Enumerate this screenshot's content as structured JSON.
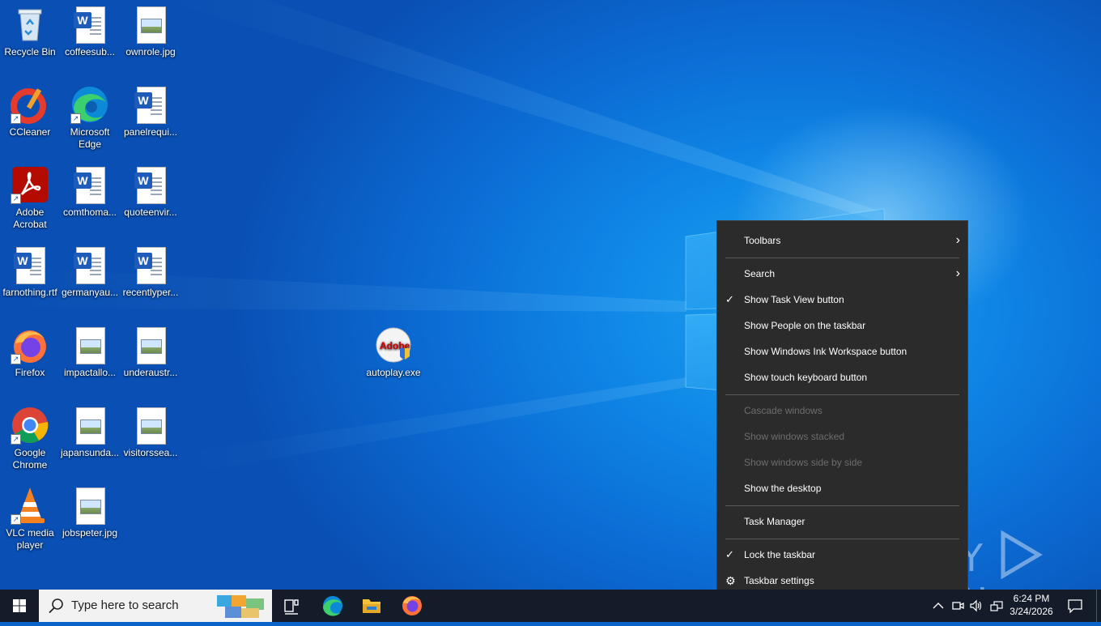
{
  "desktop": {
    "icons": [
      {
        "label": "Recycle Bin",
        "icon": "recycle-bin-icon"
      },
      {
        "label": "coffeesub...",
        "icon": "word-doc-icon"
      },
      {
        "label": "ownrole.jpg",
        "icon": "image-file-icon"
      },
      {
        "label": "CCleaner",
        "icon": "ccleaner-icon"
      },
      {
        "label": "Microsoft Edge",
        "icon": "edge-icon"
      },
      {
        "label": "panelrequi...",
        "icon": "word-doc-icon"
      },
      {
        "label": "Adobe Acrobat",
        "icon": "acrobat-icon"
      },
      {
        "label": "comthoma...",
        "icon": "word-doc-icon"
      },
      {
        "label": "quoteenvir...",
        "icon": "word-doc-icon"
      },
      {
        "label": "farnothing.rtf",
        "icon": "word-doc-icon"
      },
      {
        "label": "germanyau...",
        "icon": "word-doc-icon"
      },
      {
        "label": "recentlyper...",
        "icon": "word-doc-icon"
      },
      {
        "label": "Firefox",
        "icon": "firefox-icon"
      },
      {
        "label": "impactallo...",
        "icon": "image-file-icon"
      },
      {
        "label": "underaustr...",
        "icon": "image-file-icon"
      },
      {
        "label": "Google Chrome",
        "icon": "chrome-icon"
      },
      {
        "label": "japansunda...",
        "icon": "image-file-icon"
      },
      {
        "label": "visitorssea...",
        "icon": "image-file-icon"
      },
      {
        "label": "VLC media player",
        "icon": "vlc-icon"
      },
      {
        "label": "jobspeter.jpg",
        "icon": "image-file-icon"
      },
      {
        "label": "autoplay.exe",
        "icon": "adobe-installer-icon"
      }
    ]
  },
  "context_menu": {
    "items": [
      {
        "label": "Toolbars",
        "submenu": true,
        "checked": false,
        "enabled": true
      },
      {
        "label": "Search",
        "submenu": true,
        "checked": false,
        "enabled": true
      },
      {
        "label": "Show Task View button",
        "checked": true,
        "enabled": true
      },
      {
        "label": "Show People on the taskbar",
        "checked": false,
        "enabled": true
      },
      {
        "label": "Show Windows Ink Workspace button",
        "checked": false,
        "enabled": true
      },
      {
        "label": "Show touch keyboard button",
        "checked": false,
        "enabled": true
      },
      {
        "label": "Cascade windows",
        "checked": false,
        "enabled": false
      },
      {
        "label": "Show windows stacked",
        "checked": false,
        "enabled": false
      },
      {
        "label": "Show windows side by side",
        "checked": false,
        "enabled": false
      },
      {
        "label": "Show the desktop",
        "checked": false,
        "enabled": true
      },
      {
        "label": "Task Manager",
        "checked": false,
        "enabled": true
      },
      {
        "label": "Lock the taskbar",
        "checked": true,
        "enabled": true
      },
      {
        "label": "Taskbar settings",
        "icon": "gear-icon",
        "enabled": true
      }
    ]
  },
  "watermark": {
    "text_left": "ANY",
    "text_right": "RUN"
  },
  "taskbar": {
    "search_placeholder": "Type here to search",
    "pinned": [
      "task-view-icon",
      "edge-icon",
      "file-explorer-icon",
      "firefox-icon"
    ],
    "tray_icons": [
      "chevron-up-icon",
      "meet-now-icon",
      "volume-icon",
      "network-icon"
    ],
    "clock": {
      "time": "6:24 PM",
      "date": "3/24/2026"
    }
  },
  "colors": {
    "menu_bg": "#2b2b2b",
    "menu_disabled": "#6d6d6d",
    "taskbar_bg": "#141c2a",
    "wallpaper_blue": "#0b6bd3"
  }
}
